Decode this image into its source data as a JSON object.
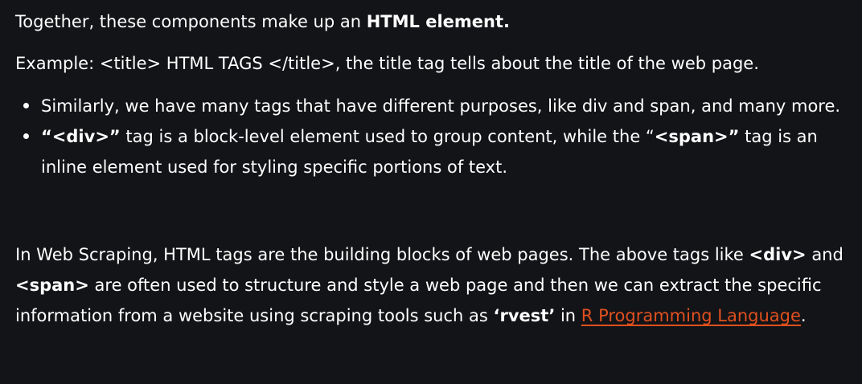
{
  "p1": {
    "text": "Together, these components make up an ",
    "bold": "HTML element."
  },
  "p2": {
    "text": "Example: <title> HTML TAGS </title>, the title tag tells about the title of the web page."
  },
  "bullets": {
    "b1": "Similarly, we have many tags that have different purposes, like div and span, and many more.",
    "b2": {
      "bold1": "“<div>”",
      "t1": " tag is a block-level element used to group content, while the “",
      "bold2": "<span>”",
      "t2": " tag is an inline element used for styling specific portions of text."
    }
  },
  "p3": {
    "t1": "In Web Scraping, HTML tags are the building blocks of web pages. The above tags like ",
    "bold1": "<div>",
    "t2": " and ",
    "bold2": "<span>",
    "t3": " are often used to structure and style a web page and then we can extract the specific information from a website using scraping tools such as ",
    "bold3": "‘rvest’",
    "t4": " in ",
    "link": "R Programming Language",
    "t5": "."
  },
  "colors": {
    "background": "#131417",
    "text": "#ffffff",
    "link": "#e0501f"
  }
}
